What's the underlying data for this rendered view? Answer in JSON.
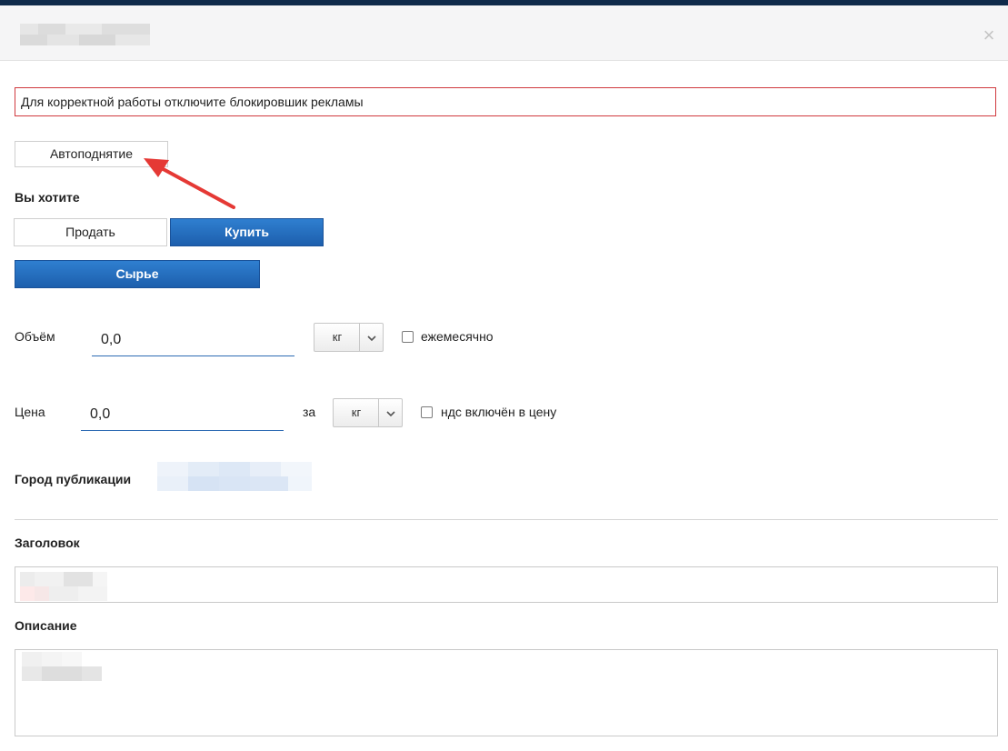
{
  "header": {
    "close_glyph": "×"
  },
  "alert": {
    "text": "Для корректной работы отключите блокировшик рекламы"
  },
  "autoraise": {
    "label": "Автоподнятие"
  },
  "intent": {
    "label": "Вы хотите",
    "sell_label": "Продать",
    "buy_label": "Купить",
    "selected": "Купить"
  },
  "category": {
    "label": "Сырье"
  },
  "volume": {
    "label": "Объём",
    "value": "0,0",
    "unit": "кг",
    "monthly_label": "ежемесячно",
    "monthly_checked": false
  },
  "price": {
    "label": "Цена",
    "value": "0,0",
    "per_label": "за",
    "unit": "кг",
    "vat_label": "ндс включён в цену",
    "vat_checked": false
  },
  "city": {
    "label": "Город публикации"
  },
  "title_field": {
    "label": "Заголовок"
  },
  "description_field": {
    "label": "Описание"
  },
  "icons": {
    "close": "close-icon",
    "dropdown": "chevron-down-icon",
    "annotation": "arrow-annotation"
  },
  "colors": {
    "top_bar": "#0f2a4a",
    "primary_button": "#2a72c4",
    "alert_border": "#d0393e",
    "input_underline": "#2d6bb3",
    "annotation_arrow": "#e53935"
  }
}
